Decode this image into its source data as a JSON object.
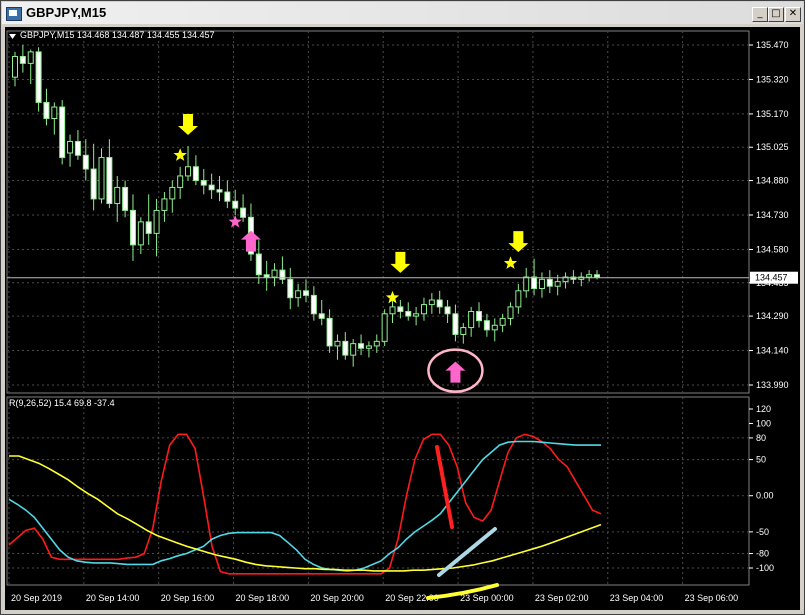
{
  "window": {
    "title": "GBPJPY,M15",
    "buttons": {
      "minimize": "_",
      "restore": "□",
      "close": "✕"
    },
    "icons": {
      "app": "chart-window-icon",
      "minimize": "minimize-icon",
      "restore": "restore-icon",
      "close": "close-icon",
      "menu": "triangle-down-icon"
    }
  },
  "colors": {
    "background": "#000000",
    "grid": "#4b4b4b",
    "axis_text": "#ffffff",
    "candle_bull": "#000000",
    "candle_bear": "#ffffff",
    "candle_outline": "#90ee90",
    "signal_sell": "#ffff00",
    "signal_buy": "#ff66cc",
    "line_red": "#ff1a1a",
    "line_cyan": "#4fd8e6",
    "line_yellow": "#ffff33",
    "circle": "#ffb6c8",
    "drawn_light_blue": "#add8e6"
  },
  "chart_data": [
    {
      "type": "candlestick",
      "symbol_info": "GBPJPY,M15  134.468 134.487 134.455 134.457",
      "ylim": [
        133.99,
        135.47
      ],
      "y_ticks": [
        "135.470",
        "135.320",
        "135.170",
        "135.025",
        "134.880",
        "134.730",
        "134.580",
        "134.435",
        "134.290",
        "134.140",
        "133.990"
      ],
      "current_price": "134.457",
      "candles": [
        [
          135.33,
          135.44,
          135.29,
          135.42
        ],
        [
          135.42,
          135.47,
          135.35,
          135.39
        ],
        [
          135.39,
          135.45,
          135.3,
          135.44
        ],
        [
          135.44,
          135.46,
          135.18,
          135.22
        ],
        [
          135.22,
          135.28,
          135.12,
          135.15
        ],
        [
          135.15,
          135.22,
          135.08,
          135.2
        ],
        [
          135.2,
          135.23,
          134.95,
          134.98
        ],
        [
          135.0,
          135.08,
          134.94,
          135.05
        ],
        [
          135.05,
          135.1,
          134.97,
          134.99
        ],
        [
          134.99,
          135.06,
          134.88,
          134.93
        ],
        [
          134.93,
          135.04,
          134.75,
          134.8
        ],
        [
          134.8,
          135.02,
          134.78,
          134.98
        ],
        [
          134.98,
          135.06,
          134.76,
          134.78
        ],
        [
          134.78,
          134.9,
          134.7,
          134.85
        ],
        [
          134.85,
          134.88,
          134.72,
          134.75
        ],
        [
          134.75,
          134.82,
          134.53,
          134.6
        ],
        [
          134.6,
          134.72,
          134.56,
          134.7
        ],
        [
          134.7,
          134.82,
          134.6,
          134.65
        ],
        [
          134.65,
          134.8,
          134.55,
          134.75
        ],
        [
          134.75,
          134.83,
          134.7,
          134.8
        ],
        [
          134.8,
          134.88,
          134.74,
          134.85
        ],
        [
          134.85,
          134.94,
          134.8,
          134.9
        ],
        [
          134.9,
          135.03,
          134.88,
          134.94
        ],
        [
          134.94,
          134.99,
          134.86,
          134.88
        ],
        [
          134.88,
          134.93,
          134.82,
          134.86
        ],
        [
          134.86,
          134.91,
          134.8,
          134.84
        ],
        [
          134.84,
          134.9,
          134.79,
          134.83
        ],
        [
          134.83,
          134.88,
          134.76,
          134.79
        ],
        [
          134.79,
          134.84,
          134.73,
          134.76
        ],
        [
          134.76,
          134.82,
          134.7,
          134.72
        ],
        [
          134.72,
          134.78,
          134.53,
          134.56
        ],
        [
          134.56,
          134.62,
          134.43,
          134.47
        ],
        [
          134.47,
          134.53,
          134.4,
          134.46
        ],
        [
          134.46,
          134.52,
          134.42,
          134.49
        ],
        [
          134.49,
          134.55,
          134.43,
          134.45
        ],
        [
          134.45,
          134.5,
          134.32,
          134.37
        ],
        [
          134.37,
          134.43,
          134.33,
          134.4
        ],
        [
          134.4,
          134.45,
          134.35,
          134.38
        ],
        [
          134.38,
          134.42,
          134.27,
          134.3
        ],
        [
          134.3,
          134.36,
          134.25,
          134.28
        ],
        [
          134.28,
          134.32,
          134.13,
          134.16
        ],
        [
          134.16,
          134.21,
          134.1,
          134.18
        ],
        [
          134.18,
          134.22,
          134.1,
          134.12
        ],
        [
          134.12,
          134.19,
          134.07,
          134.17
        ],
        [
          134.17,
          134.21,
          134.12,
          134.15
        ],
        [
          134.15,
          134.18,
          134.11,
          134.16
        ],
        [
          134.16,
          134.21,
          134.13,
          134.18
        ],
        [
          134.18,
          134.32,
          134.16,
          134.3
        ],
        [
          134.3,
          134.37,
          134.26,
          134.33
        ],
        [
          134.33,
          134.36,
          134.28,
          134.31
        ],
        [
          134.31,
          134.35,
          134.27,
          134.29
        ],
        [
          134.29,
          134.33,
          134.25,
          134.3
        ],
        [
          134.3,
          134.37,
          134.27,
          134.34
        ],
        [
          134.34,
          134.39,
          134.3,
          134.36
        ],
        [
          134.36,
          134.4,
          134.3,
          134.33
        ],
        [
          134.33,
          134.36,
          134.26,
          134.3
        ],
        [
          134.3,
          134.34,
          134.18,
          134.21
        ],
        [
          134.21,
          134.26,
          134.17,
          134.24
        ],
        [
          134.24,
          134.33,
          134.2,
          134.31
        ],
        [
          134.31,
          134.35,
          134.24,
          134.27
        ],
        [
          134.27,
          134.3,
          134.2,
          134.23
        ],
        [
          134.23,
          134.28,
          134.18,
          134.25
        ],
        [
          134.25,
          134.3,
          134.22,
          134.28
        ],
        [
          134.28,
          134.35,
          134.25,
          134.33
        ],
        [
          134.33,
          134.43,
          134.3,
          134.4
        ],
        [
          134.4,
          134.5,
          134.37,
          134.46
        ],
        [
          134.46,
          134.54,
          134.38,
          134.41
        ],
        [
          134.41,
          134.48,
          134.37,
          134.45
        ],
        [
          134.45,
          134.49,
          134.39,
          134.42
        ],
        [
          134.42,
          134.47,
          134.38,
          134.44
        ],
        [
          134.44,
          134.48,
          134.41,
          134.46
        ],
        [
          134.46,
          134.49,
          134.43,
          134.45
        ],
        [
          134.45,
          134.48,
          134.42,
          134.46
        ],
        [
          134.46,
          134.49,
          134.44,
          134.47
        ],
        [
          134.47,
          134.49,
          134.45,
          134.46
        ]
      ],
      "signals": [
        {
          "type": "sell-arrow",
          "index": 22,
          "price": 135.1
        },
        {
          "type": "star",
          "index": 21,
          "color": "yellow",
          "price": 134.99
        },
        {
          "type": "star",
          "index": 28,
          "color": "pink",
          "price": 134.7
        },
        {
          "type": "buy-arrow",
          "index": 30,
          "price": 134.64
        },
        {
          "type": "sell-arrow",
          "index": 49,
          "price": 134.5
        },
        {
          "type": "star",
          "index": 48,
          "color": "yellow",
          "price": 134.37
        },
        {
          "type": "buy-arrow",
          "index": 56,
          "price": 134.07
        },
        {
          "type": "sell-arrow",
          "index": 64,
          "price": 134.59
        },
        {
          "type": "star",
          "index": 63,
          "color": "yellow",
          "price": 134.52
        }
      ]
    },
    {
      "type": "line",
      "indicator_label": "R(9,26,52) 15.4 69.8 -37.4",
      "ylim": [
        -118,
        120
      ],
      "y_ticks": [
        "120",
        "100",
        "80",
        "50",
        "0.00",
        "-50",
        "-80",
        "-100"
      ],
      "x_labels": [
        "20 Sep 2019",
        "20 Sep 14:00",
        "20 Sep 16:00",
        "20 Sep 18:00",
        "20 Sep 20:00",
        "20 Sep 22:00",
        "23 Sep 00:00",
        "23 Sep 02:00",
        "23 Sep 04:00",
        "23 Sep 06:00"
      ],
      "series": [
        {
          "color": "red",
          "values": [
            -68,
            -58,
            -48,
            -45,
            -60,
            -85,
            -88,
            -88,
            -88,
            -88,
            -88,
            -88,
            -88,
            -88,
            -86,
            -85,
            -80,
            -45,
            20,
            70,
            85,
            85,
            65,
            0,
            -70,
            -105,
            -108,
            -108,
            -108,
            -108,
            -108,
            -108,
            -108,
            -108,
            -108,
            -108,
            -108,
            -108,
            -108,
            -108,
            -108,
            -108,
            -108,
            -108,
            -108,
            -100,
            -60,
            0,
            50,
            78,
            85,
            85,
            70,
            40,
            -10,
            -30,
            -35,
            -20,
            20,
            60,
            80,
            85,
            82,
            75,
            65,
            50,
            40,
            20,
            0,
            -20,
            -25
          ]
        },
        {
          "color": "cyan",
          "values": [
            -5,
            -12,
            -20,
            -30,
            -45,
            -60,
            -75,
            -85,
            -90,
            -92,
            -93,
            -93,
            -93,
            -94,
            -95,
            -95,
            -95,
            -95,
            -90,
            -87,
            -83,
            -80,
            -75,
            -70,
            -60,
            -55,
            -52,
            -51,
            -51,
            -51,
            -51,
            -51,
            -55,
            -65,
            -75,
            -88,
            -95,
            -100,
            -102,
            -103,
            -104,
            -103,
            -100,
            -95,
            -90,
            -80,
            -72,
            -60,
            -50,
            -42,
            -34,
            -25,
            -10,
            5,
            20,
            35,
            50,
            60,
            70,
            74,
            75,
            75,
            75,
            74,
            73,
            72,
            71,
            70,
            70,
            70,
            70
          ]
        },
        {
          "color": "yellow",
          "values": [
            55,
            55,
            50,
            45,
            38,
            30,
            22,
            12,
            3,
            -5,
            -15,
            -25,
            -32,
            -40,
            -48,
            -55,
            -60,
            -65,
            -70,
            -74,
            -78,
            -82,
            -85,
            -88,
            -92,
            -95,
            -97,
            -98,
            -99,
            -100,
            -101,
            -101,
            -102,
            -102,
            -103,
            -103,
            -103,
            -104,
            -104,
            -104,
            -104,
            -103,
            -103,
            -102,
            -101,
            -100,
            -98,
            -96,
            -93,
            -90,
            -86,
            -82,
            -78,
            -74,
            -70,
            -65,
            -60,
            -55,
            -50,
            -45,
            -40
          ]
        }
      ]
    }
  ],
  "annotations": {
    "circle_label": "buy-signal-circle",
    "red_stroke_label": "drawn-red-line",
    "light_blue_stroke_label": "drawn-blue-line",
    "yellow_stroke_label": "drawn-yellow-line"
  }
}
